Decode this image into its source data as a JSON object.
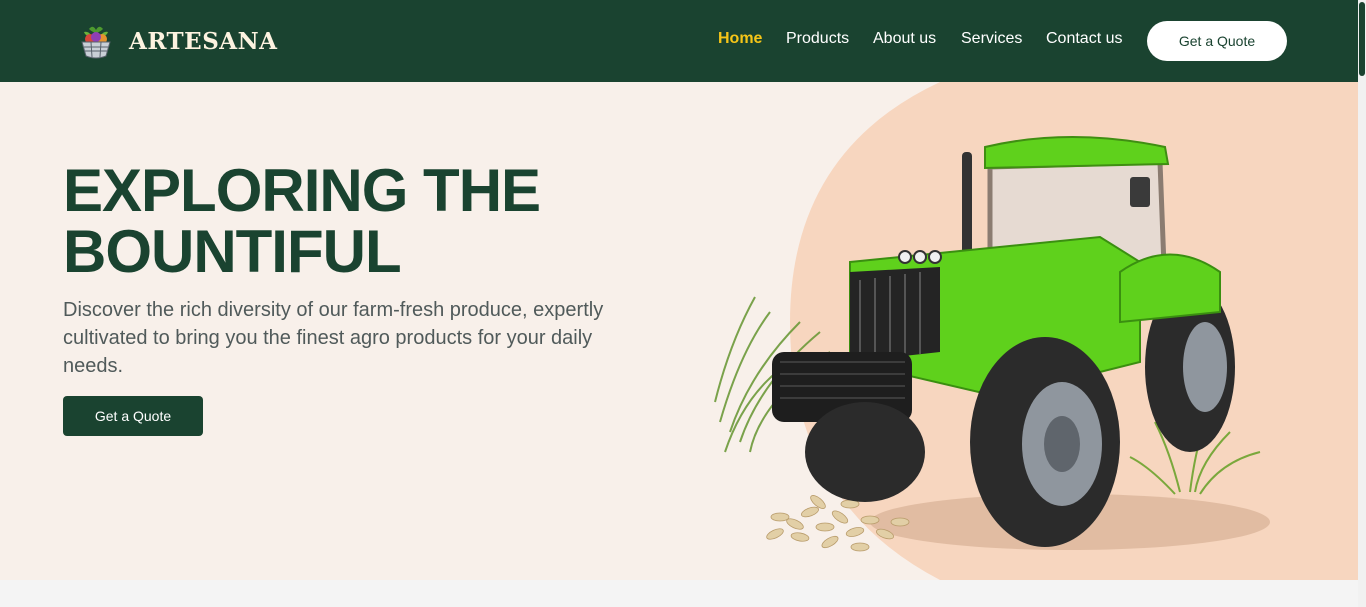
{
  "brand": {
    "name": "ARTESANA",
    "logo_icon": "fruit-basket-icon"
  },
  "nav": {
    "items": [
      {
        "label": "Home",
        "active": true
      },
      {
        "label": "Products",
        "active": false
      },
      {
        "label": "About us",
        "active": false
      },
      {
        "label": "Services",
        "active": false
      },
      {
        "label": "Contact us",
        "active": false
      }
    ],
    "quote_button": "Get a Quote"
  },
  "hero": {
    "title_line1": "EXPLORING THE",
    "title_line2": "BOUNTIFUL",
    "description": "Discover the rich diversity of our farm-fresh produce, expertly cultivated to bring you the finest agro products for your daily needs.",
    "button": "Get a Quote",
    "image": "green-tractor-with-grass-and-seeds"
  },
  "colors": {
    "primary": "#1a4330",
    "accent": "#f5c518",
    "hero_bg": "#f8f0ea",
    "hero_blob": "#f7d6bf",
    "tractor_green": "#5fd11c"
  }
}
